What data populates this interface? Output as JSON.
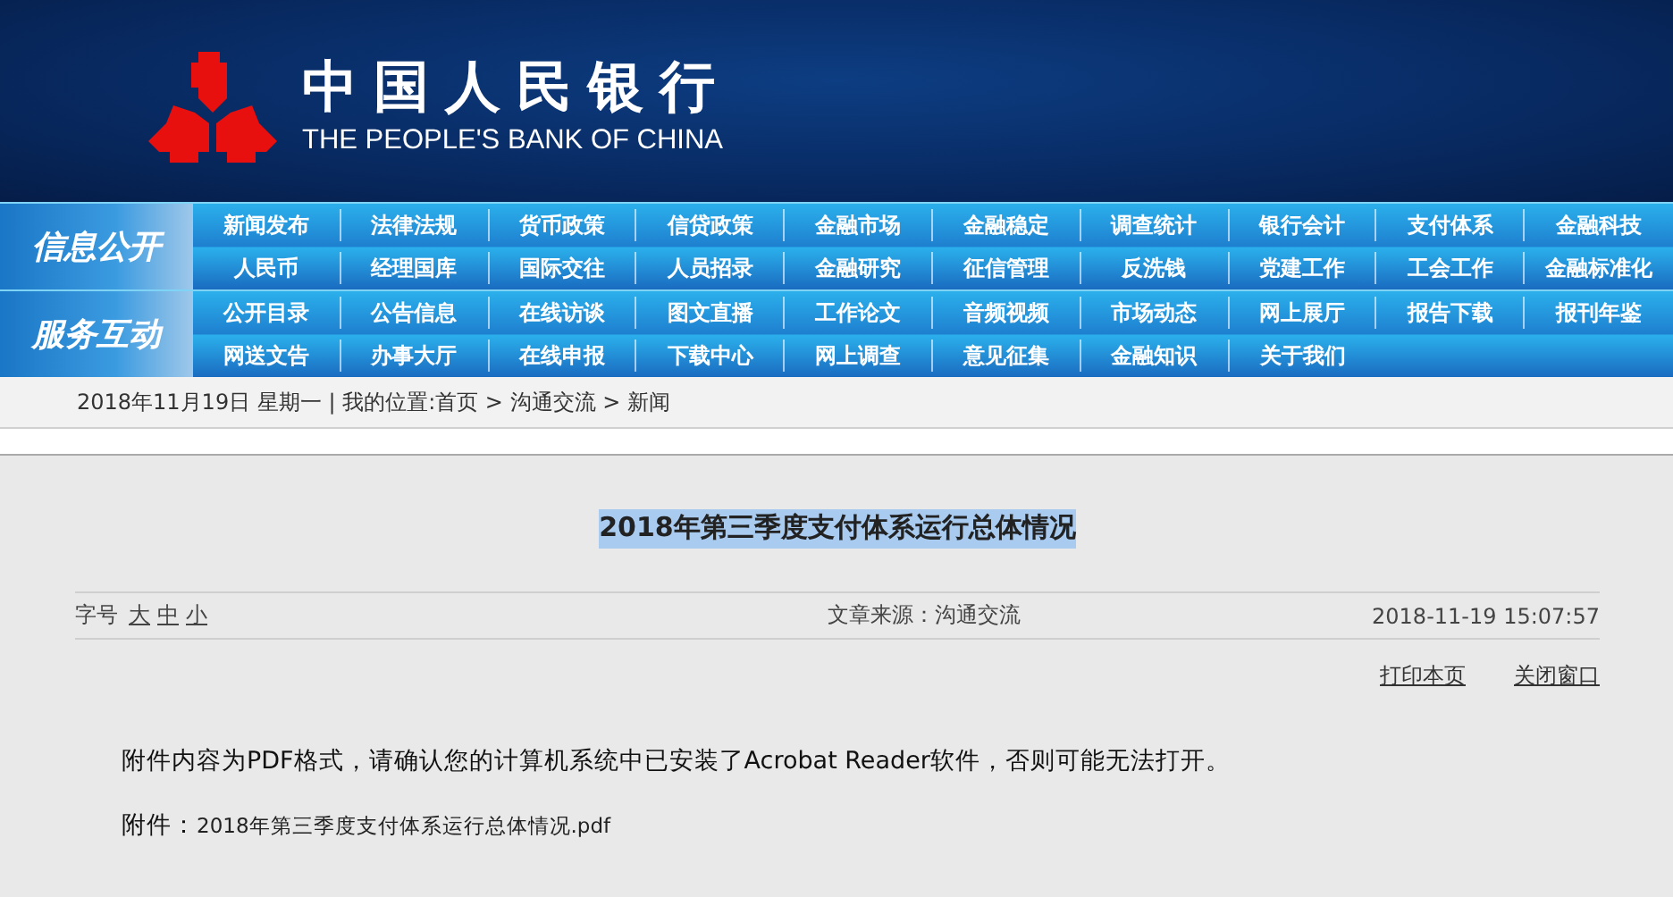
{
  "header": {
    "name_cn": "中国人民银行",
    "name_en": "THE PEOPLE'S BANK OF CHINA"
  },
  "nav": [
    {
      "label": "信息公开",
      "rows": [
        [
          "新闻发布",
          "法律法规",
          "货币政策",
          "信贷政策",
          "金融市场",
          "金融稳定",
          "调查统计",
          "银行会计",
          "支付体系",
          "金融科技"
        ],
        [
          "人民币",
          "经理国库",
          "国际交往",
          "人员招录",
          "金融研究",
          "征信管理",
          "反洗钱",
          "党建工作",
          "工会工作",
          "金融标准化"
        ]
      ]
    },
    {
      "label": "服务互动",
      "rows": [
        [
          "公开目录",
          "公告信息",
          "在线访谈",
          "图文直播",
          "工作论文",
          "音频视频",
          "市场动态",
          "网上展厅",
          "报告下载",
          "报刊年鉴"
        ],
        [
          "网送文告",
          "办事大厅",
          "在线申报",
          "下载中心",
          "网上调查",
          "意见征集",
          "金融知识",
          "关于我们"
        ]
      ]
    }
  ],
  "breadcrumb": "2018年11月19日 星期一 | 我的位置:首页 > 沟通交流 > 新闻",
  "article": {
    "title": "2018年第三季度支付体系运行总体情况",
    "title_highlighted": true,
    "font_size_label": "字号",
    "font_sizes": [
      "大",
      "中",
      "小"
    ],
    "source": "文章来源：沟通交流",
    "datetime": "2018-11-19 15:07:57",
    "actions": [
      "打印本页",
      "关闭窗口"
    ],
    "notice": "附件内容为PDF格式，请确认您的计算机系统中已安装了Acrobat Reader软件，否则可能无法打开。",
    "attachment_label": "附件：",
    "attachment_file": "2018年第三季度支付体系运行总体情况.pdf"
  }
}
